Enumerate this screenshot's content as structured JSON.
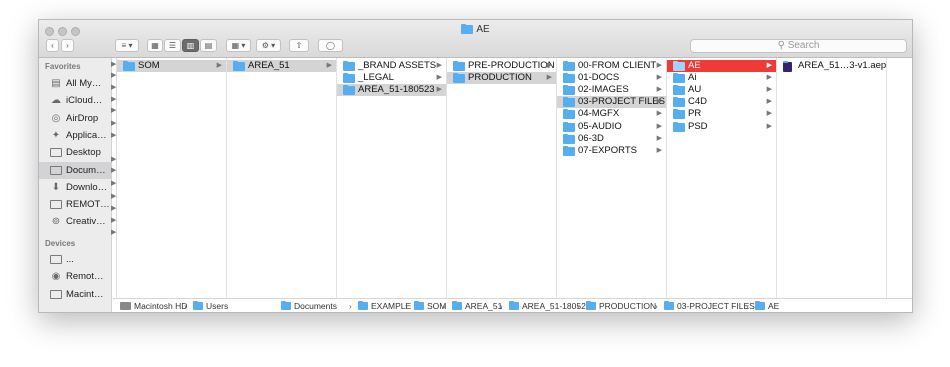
{
  "window": {
    "title": "AE"
  },
  "toolbar": {
    "view_dropdown": "≡ ▾",
    "icon_view": "▦",
    "list_view": "☰",
    "column_view": "▥",
    "gallery_view": "▤",
    "arrange": "▦ ▾",
    "action": "⚙ ▾",
    "share": "⇧",
    "tag": "◯",
    "back": "‹",
    "forward": "›"
  },
  "search": {
    "placeholder": "Search"
  },
  "sidebar": {
    "favorites_header": "Favorites",
    "favorites": [
      {
        "label": "All My…",
        "icon": "all-files-icon"
      },
      {
        "label": "iCloud…",
        "icon": "cloud-icon"
      },
      {
        "label": "AirDrop",
        "icon": "airdrop-icon"
      },
      {
        "label": "Applica…",
        "icon": "applications-icon"
      },
      {
        "label": "Desktop",
        "icon": "desktop-icon"
      },
      {
        "label": "Docum…",
        "icon": "documents-icon"
      },
      {
        "label": "Downlo…",
        "icon": "downloads-icon"
      },
      {
        "label": "REMOT…",
        "icon": "folder-icon"
      },
      {
        "label": "Creativ…",
        "icon": "creative-cloud-icon"
      }
    ],
    "devices_header": "Devices",
    "devices": [
      {
        "label": "...",
        "icon": "laptop-icon"
      },
      {
        "label": "Remot…",
        "icon": "disc-icon"
      },
      {
        "label": "Macint…",
        "icon": "disk-icon"
      }
    ]
  },
  "columns": [
    {
      "items": [
        {
          "name": "SOM",
          "state": "selected"
        }
      ]
    },
    {
      "items": [
        {
          "name": "AREA_51",
          "state": "selected"
        }
      ]
    },
    {
      "items": [
        {
          "name": "_BRAND ASSETS"
        },
        {
          "name": "_LEGAL"
        },
        {
          "name": "AREA_51-180523",
          "state": "selected"
        }
      ]
    },
    {
      "items": [
        {
          "name": "PRE-PRODUCTION"
        },
        {
          "name": "PRODUCTION",
          "state": "selected"
        }
      ]
    },
    {
      "items": [
        {
          "name": "00-FROM CLIENT"
        },
        {
          "name": "01-DOCS"
        },
        {
          "name": "02-IMAGES"
        },
        {
          "name": "03-PROJECT FILES",
          "state": "selected"
        },
        {
          "name": "04-MGFX"
        },
        {
          "name": "05-AUDIO"
        },
        {
          "name": "06-3D"
        },
        {
          "name": "07-EXPORTS"
        }
      ]
    },
    {
      "items": [
        {
          "name": "AE",
          "state": "active"
        },
        {
          "name": "Ai"
        },
        {
          "name": "AU"
        },
        {
          "name": "C4D"
        },
        {
          "name": "PR"
        },
        {
          "name": "PSD"
        }
      ]
    },
    {
      "items": [
        {
          "name": "AREA_51…3-v1.aep",
          "kind": "file"
        }
      ]
    }
  ],
  "pathbar": [
    {
      "label": "Macintosh HD",
      "icon": "hard-drive-icon"
    },
    {
      "label": "Users"
    },
    {
      "label": "Documents"
    },
    {
      "label": "EXAMPLE"
    },
    {
      "label": "SOM"
    },
    {
      "label": "AREA_51"
    },
    {
      "label": "AREA_51-180523"
    },
    {
      "label": "PRODUCTION"
    },
    {
      "label": "03-PROJECT FILES"
    },
    {
      "label": "AE"
    }
  ],
  "colors": {
    "accent_selection": "#ee3b38",
    "folder": "#56aef0",
    "inactive_selection": "#d4d4d4"
  }
}
